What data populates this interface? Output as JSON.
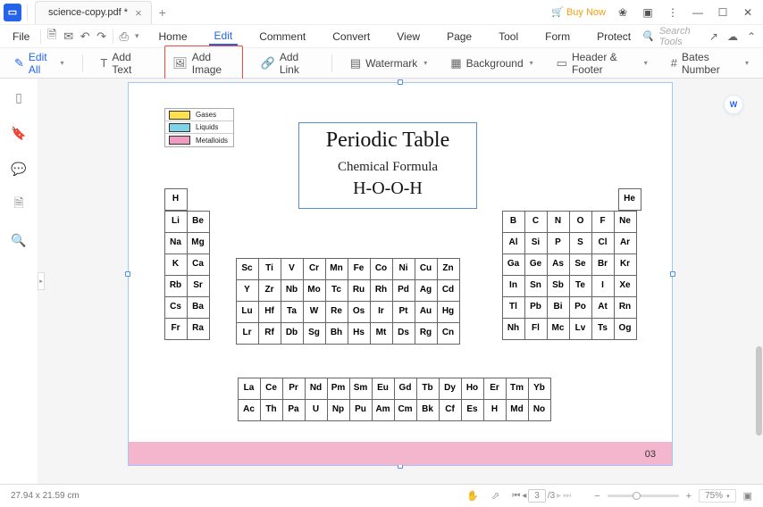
{
  "titlebar": {
    "tab_name": "science-copy.pdf *",
    "buy_now": "Buy Now"
  },
  "file_menu": "File",
  "menu": {
    "home": "Home",
    "edit": "Edit",
    "comment": "Comment",
    "convert": "Convert",
    "view": "View",
    "page": "Page",
    "tool": "Tool",
    "form": "Form",
    "protect": "Protect"
  },
  "search_placeholder": "Search Tools",
  "toolbar": {
    "edit_all": "Edit All",
    "add_text": "Add Text",
    "add_image": "Add Image",
    "add_link": "Add Link",
    "watermark": "Watermark",
    "background": "Background",
    "header_footer": "Header & Footer",
    "bates_number": "Bates Number"
  },
  "legend": {
    "gases": "Gases",
    "liquids": "Liquids",
    "metalloids": "Metalloids"
  },
  "doc": {
    "title": "Periodic Table",
    "subtitle": "Chemical Formula",
    "formula": "H-O-O-H",
    "page_num": "03"
  },
  "chart_data": {
    "type": "table",
    "title": "Periodic Table",
    "legend": [
      "Gases",
      "Liquids",
      "Metalloids"
    ],
    "main_block_rows": [
      [
        "H",
        "",
        "",
        "",
        "",
        "",
        "",
        "",
        "",
        "",
        "",
        "",
        "",
        "",
        "",
        "",
        "",
        "He"
      ],
      [
        "Li",
        "Be",
        "",
        "",
        "",
        "",
        "",
        "",
        "",
        "",
        "",
        "",
        "B",
        "C",
        "N",
        "O",
        "F",
        "Ne"
      ],
      [
        "Na",
        "Mg",
        "",
        "",
        "",
        "",
        "",
        "",
        "",
        "",
        "",
        "",
        "Al",
        "Si",
        "P",
        "S",
        "Cl",
        "Ar"
      ],
      [
        "K",
        "Ca",
        "Sc",
        "Ti",
        "V",
        "Cr",
        "Mn",
        "Fe",
        "Co",
        "Ni",
        "Cu",
        "Zn",
        "Ga",
        "Ge",
        "As",
        "Se",
        "Br",
        "Kr"
      ],
      [
        "Rb",
        "Sr",
        "Y",
        "Zr",
        "Nb",
        "Mo",
        "Tc",
        "Ru",
        "Rh",
        "Pd",
        "Ag",
        "Cd",
        "In",
        "Sn",
        "Sb",
        "Te",
        "I",
        "Xe"
      ],
      [
        "Cs",
        "Ba",
        "Lu",
        "Hf",
        "Ta",
        "W",
        "Re",
        "Os",
        "Ir",
        "Pt",
        "Au",
        "Hg",
        "Tl",
        "Pb",
        "Bi",
        "Po",
        "At",
        "Rn"
      ],
      [
        "Fr",
        "Ra",
        "Lr",
        "Rf",
        "Db",
        "Sg",
        "Bh",
        "Hs",
        "Mt",
        "Ds",
        "Rg",
        "Cn",
        "Nh",
        "Fl",
        "Mc",
        "Lv",
        "Ts",
        "Og"
      ]
    ],
    "f_block_rows": [
      [
        "La",
        "Ce",
        "Pr",
        "Nd",
        "Pm",
        "Sm",
        "Eu",
        "Gd",
        "Tb",
        "Dy",
        "Ho",
        "Er",
        "Tm",
        "Yb"
      ],
      [
        "Ac",
        "Th",
        "Pa",
        "U",
        "Np",
        "Pu",
        "Am",
        "Cm",
        "Bk",
        "Cf",
        "Es",
        "H",
        "Md",
        "No"
      ]
    ],
    "colors": {
      "H": "gas",
      "He": "gas",
      "N": "gas",
      "O": "gas",
      "F": "gas",
      "Ne": "gas",
      "Cl": "gas",
      "Ar": "gas",
      "Kr": "gas",
      "Xe": "gas",
      "Rn": "gas",
      "Og": "gas",
      "Br": "liq",
      "Hg": "liq",
      "B": "met",
      "Si": "met",
      "Ge": "met",
      "As": "met",
      "Sb": "met",
      "Te": "met",
      "At": "met"
    }
  },
  "status": {
    "dims": "27.94 x 21.59 cm",
    "page_cur": "3",
    "page_total": "/3",
    "zoom_pct": "75%"
  }
}
